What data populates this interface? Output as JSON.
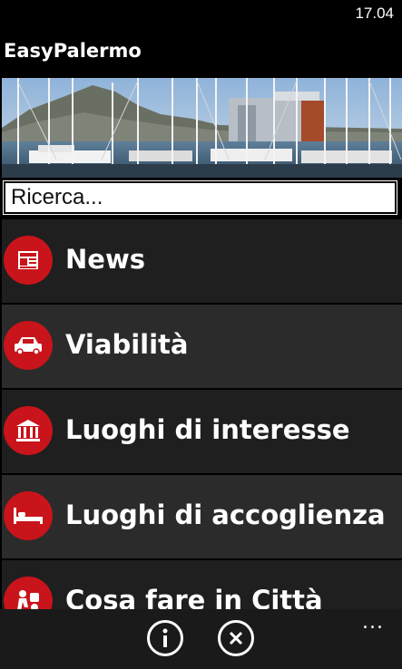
{
  "status_bar": {
    "time": "17.04"
  },
  "app": {
    "title": "EasyPalermo"
  },
  "banner": {
    "image": "marina-harbor-photo"
  },
  "search": {
    "placeholder": "Ricerca..."
  },
  "menu": {
    "items": [
      {
        "label": "News",
        "icon": "newspaper-icon"
      },
      {
        "label": "Viabilità",
        "icon": "car-icon"
      },
      {
        "label": "Luoghi di interesse",
        "icon": "museum-icon"
      },
      {
        "label": "Luoghi di accoglienza",
        "icon": "bed-icon"
      },
      {
        "label": "Cosa fare in Città",
        "icon": "activities-icon"
      }
    ]
  },
  "app_bar": {
    "buttons": [
      {
        "icon": "info-icon"
      },
      {
        "icon": "close-icon"
      }
    ],
    "more": "..."
  },
  "colors": {
    "accent": "#c8141a",
    "background": "#000000",
    "row_dark": "#1f1f1f",
    "row_light": "#2b2b2b"
  }
}
